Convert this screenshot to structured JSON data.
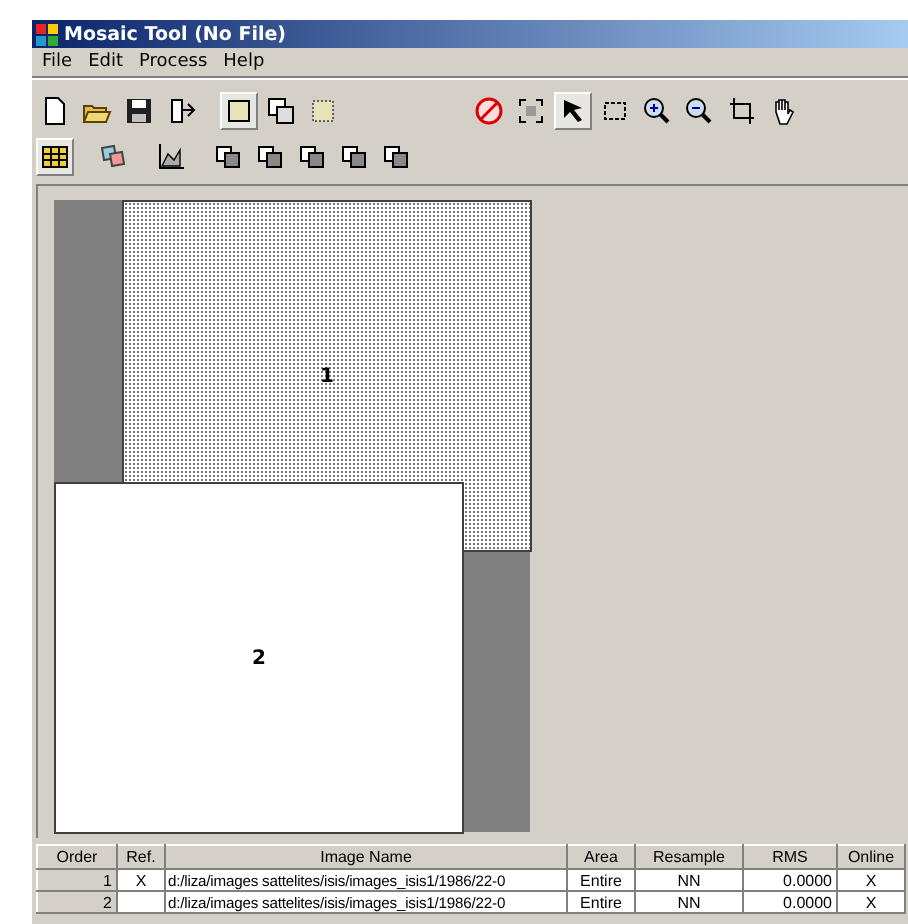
{
  "window": {
    "title": "Mosaic Tool (No File)"
  },
  "menu": [
    "File",
    "Edit",
    "Process",
    "Help"
  ],
  "toolbar_1": [
    {
      "kind": "new",
      "selected": false
    },
    {
      "kind": "open",
      "selected": false
    },
    {
      "kind": "save",
      "selected": false
    },
    {
      "kind": "export",
      "selected": false
    },
    {
      "kind": "gap"
    },
    {
      "kind": "rect",
      "selected": true
    },
    {
      "kind": "overlap",
      "selected": false
    },
    {
      "kind": "dotted",
      "selected": false
    },
    {
      "kind": "wide"
    },
    {
      "kind": "nosign",
      "selected": false
    },
    {
      "kind": "fit",
      "selected": false
    },
    {
      "kind": "arrow",
      "selected": true
    },
    {
      "kind": "select",
      "selected": false
    },
    {
      "kind": "zoomin",
      "selected": false
    },
    {
      "kind": "zoomout",
      "selected": false
    },
    {
      "kind": "crop",
      "selected": false
    },
    {
      "kind": "hand",
      "selected": false
    }
  ],
  "toolbar_2": [
    {
      "kind": "table",
      "selected": true
    },
    {
      "kind": "gap"
    },
    {
      "kind": "layers",
      "selected": false
    },
    {
      "kind": "gap"
    },
    {
      "kind": "chart",
      "selected": false
    },
    {
      "kind": "gap"
    },
    {
      "kind": "copy",
      "selected": false
    },
    {
      "kind": "copy",
      "selected": false
    },
    {
      "kind": "copy",
      "selected": false
    },
    {
      "kind": "copy",
      "selected": false
    },
    {
      "kind": "copy",
      "selected": false
    }
  ],
  "canvas": {
    "images": [
      {
        "label": "1",
        "kind": "dotted"
      },
      {
        "label": "2",
        "kind": "plain"
      }
    ]
  },
  "table": {
    "columns": [
      "Order",
      "Ref.",
      "Image Name",
      "Area",
      "Resample",
      "RMS",
      "Online"
    ],
    "rows": [
      {
        "order": "1",
        "ref": "X",
        "image_name": "d:/liza/images sattelites/isis/images_isis1/1986/22-0",
        "area": "Entire",
        "resample": "NN",
        "rms": "0.0000",
        "online": "X"
      },
      {
        "order": "2",
        "ref": "",
        "image_name": "d:/liza/images sattelites/isis/images_isis1/1986/22-0",
        "area": "Entire",
        "resample": "NN",
        "rms": "0.0000",
        "online": "X"
      }
    ]
  }
}
